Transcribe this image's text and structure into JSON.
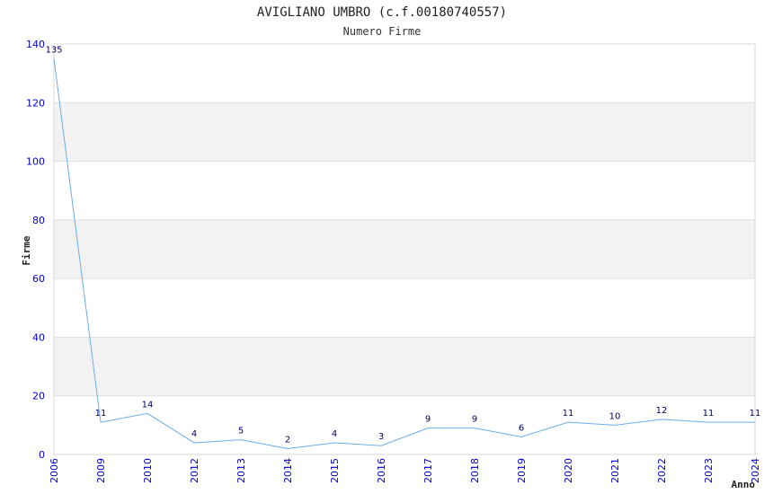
{
  "chart_data": {
    "type": "line",
    "title": "AVIGLIANO UMBRO (c.f.00180740557)",
    "subtitle": "Numero Firme",
    "xlabel": "Anno",
    "ylabel": "Firme",
    "ylim": [
      0,
      140
    ],
    "yticks": [
      0,
      20,
      40,
      60,
      80,
      100,
      120,
      140
    ],
    "grid": true,
    "categories": [
      "2006",
      "2009",
      "2010",
      "2012",
      "2013",
      "2014",
      "2015",
      "2016",
      "2017",
      "2018",
      "2019",
      "2020",
      "2021",
      "2022",
      "2023",
      "2024"
    ],
    "values": [
      135,
      11,
      14,
      4,
      5,
      2,
      4,
      3,
      9,
      9,
      6,
      11,
      10,
      12,
      11,
      11
    ],
    "colors": {
      "line": "#6aaee8",
      "band": "#f2f2f2",
      "tick_text": "#0000cc",
      "data_label": "#000066"
    }
  }
}
